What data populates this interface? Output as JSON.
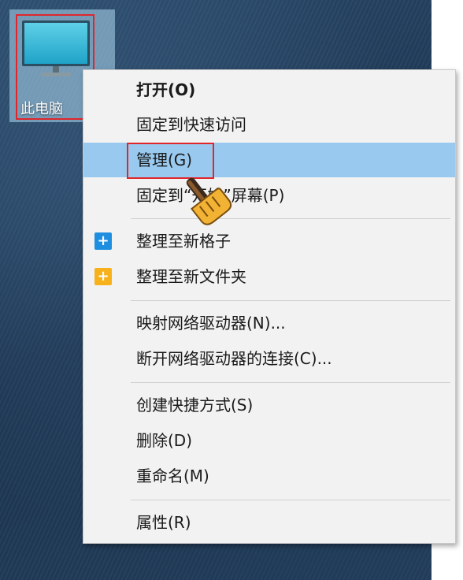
{
  "desktop": {
    "icon_label": "此电脑"
  },
  "context_menu": {
    "items": [
      {
        "label": "打开(O)"
      },
      {
        "label": "固定到快速访问"
      },
      {
        "label": "管理(G)"
      },
      {
        "label": "固定到“开始”屏幕(P)"
      },
      {
        "label": "整理至新格子",
        "icon": "plus-icon"
      },
      {
        "label": "整理至新文件夹",
        "icon": "folder-plus-icon"
      },
      {
        "label": "映射网络驱动器(N)..."
      },
      {
        "label": "断开网络驱动器的连接(C)..."
      },
      {
        "label": "创建快捷方式(S)"
      },
      {
        "label": "删除(D)"
      },
      {
        "label": "重命名(M)"
      },
      {
        "label": "属性(R)"
      }
    ],
    "selected_index": 2
  },
  "colors": {
    "highlight_border": "#e0262b",
    "selected_bg": "#99c9ef",
    "plus_icon": "#1e8fe0",
    "folder_icon": "#f7b21b"
  }
}
